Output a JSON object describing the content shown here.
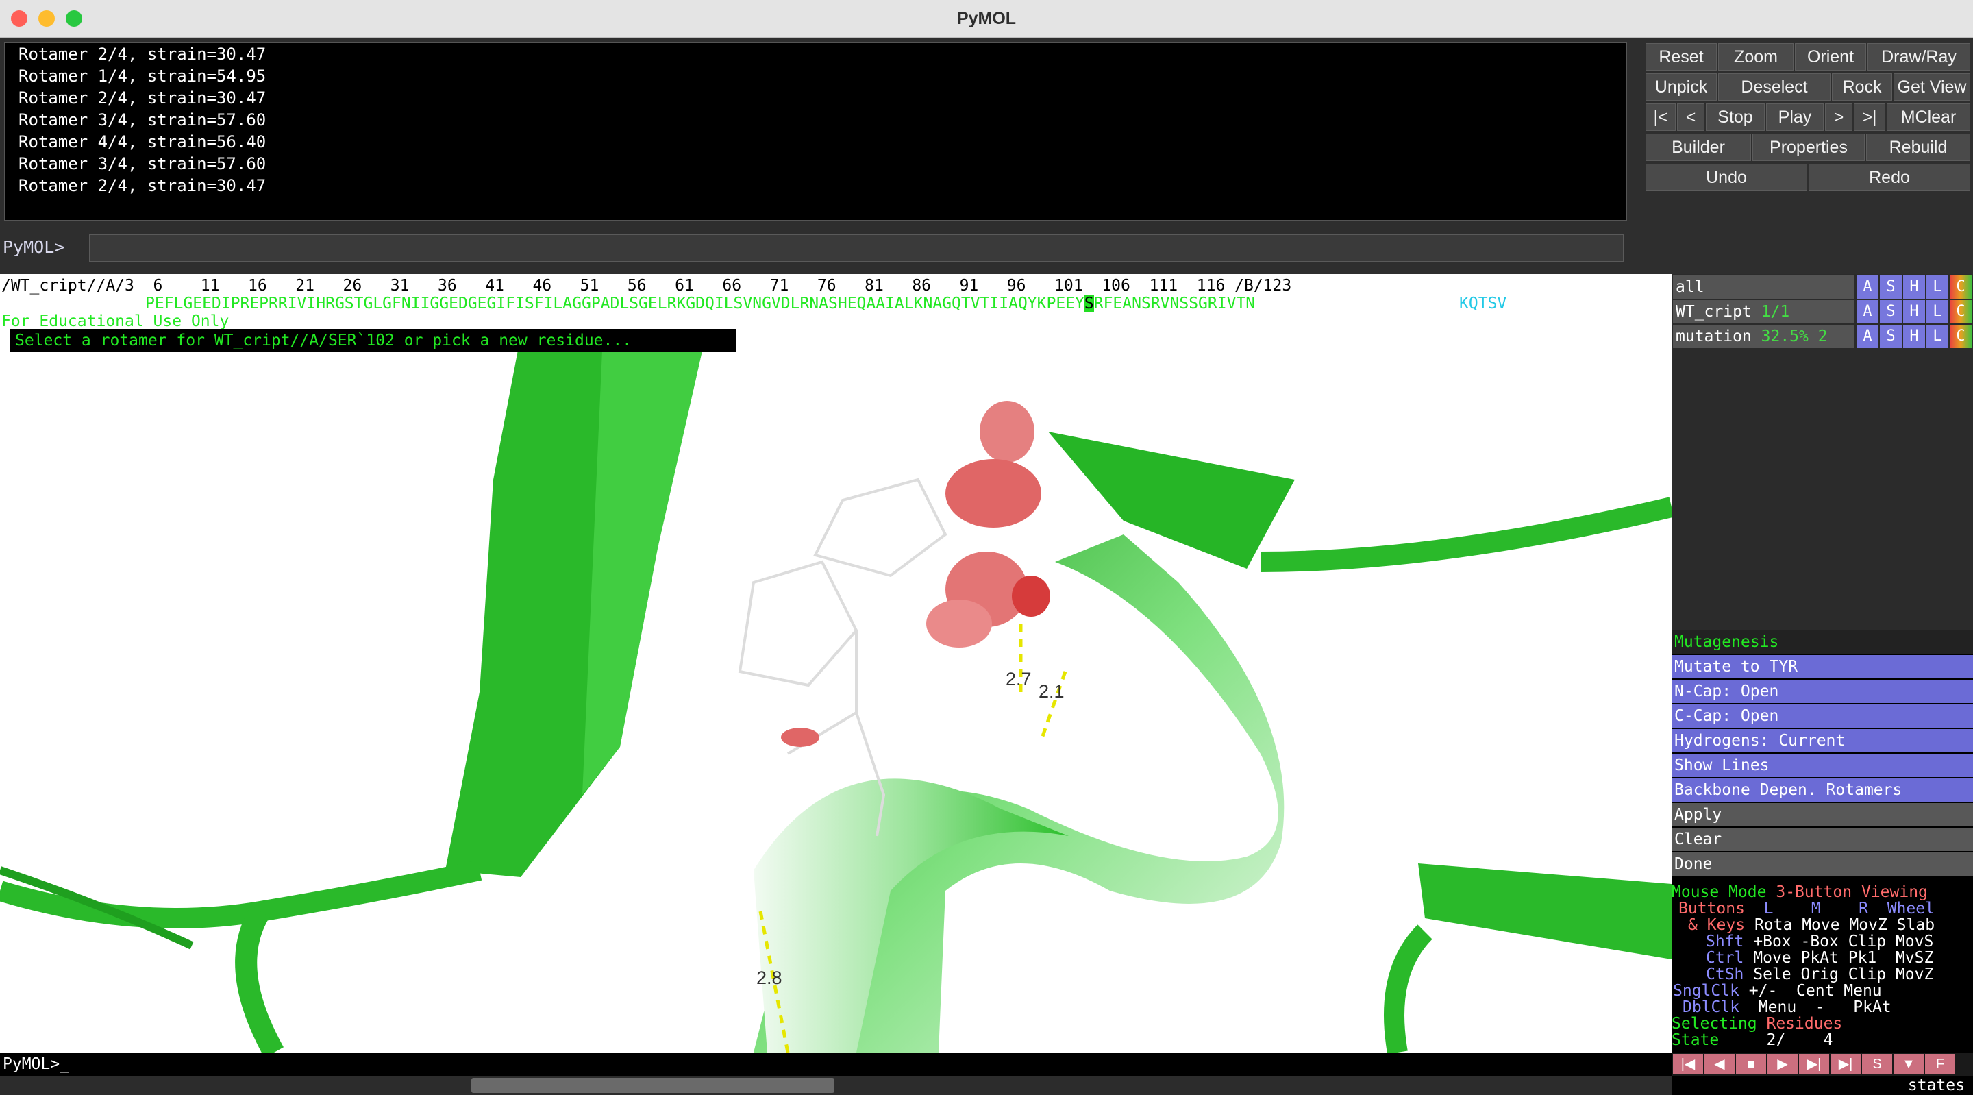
{
  "window": {
    "title": "PyMOL"
  },
  "console": {
    "lines": [
      "Rotamer 2/4, strain=30.47",
      "Rotamer 1/4, strain=54.95",
      "Rotamer 2/4, strain=30.47",
      "Rotamer 3/4, strain=57.60",
      "Rotamer 4/4, strain=56.40",
      "Rotamer 3/4, strain=57.60",
      "Rotamer 2/4, strain=30.47"
    ],
    "prompt_label": "PyMOL>",
    "command_value": ""
  },
  "buttons": {
    "reset": "Reset",
    "zoom": "Zoom",
    "orient": "Orient",
    "draw_ray": "Draw/Ray",
    "unpick": "Unpick",
    "deselect": "Deselect",
    "rock": "Rock",
    "get_view": "Get View",
    "first": "|<",
    "prev": "<",
    "stop": "Stop",
    "play": "Play",
    "next": ">",
    "last": ">|",
    "mclear": "MClear",
    "builder": "Builder",
    "properties": "Properties",
    "rebuild": "Rebuild",
    "undo": "Undo",
    "redo": "Redo"
  },
  "sequence": {
    "numbering": "/WT_cript//A/3  6    11   16   21   26   31   36   41   46   51   56   61   66   71   76   81   86   91   96   101  106  111  116 /B/123",
    "residues_before": "PEFLGEEDIPREPRRIVIHRGSTGLGFNIIGGEDGEGIFISFILAGGPADLSGELRKGDQILSVNGVDLRNASHEQAAIALKNAGQTVTIIAQYKPEEY",
    "residue_current": "S",
    "residues_after": "RFEANSRVNSSGRIVTN",
    "chain_b_residues": "KQTSV",
    "watermark": "For Educational Use Only",
    "message": "Select a rotamer for WT_cript//A/SER`102 or pick a new residue..."
  },
  "distances": [
    "2.7",
    "2.1",
    "2.8"
  ],
  "objects": [
    {
      "name": "all",
      "state": ""
    },
    {
      "name": "WT_cript",
      "state": "1/1"
    },
    {
      "name": "mutation",
      "state": "32.5% 2"
    }
  ],
  "object_buttons": [
    "A",
    "S",
    "H",
    "L",
    "C"
  ],
  "wizard": {
    "title": "Mutagenesis",
    "mutate": "Mutate to TYR",
    "ncap": "N-Cap: Open",
    "ccap": "C-Cap: Open",
    "hydrogens": "Hydrogens: Current",
    "show_lines": "Show Lines",
    "backbone": "Backbone Depen. Rotamers",
    "apply": "Apply",
    "clear": "Clear",
    "done": "Done"
  },
  "mouse": {
    "mode_label": "Mouse Mode",
    "mode_value": "3-Button Viewing",
    "header": {
      "buttons": "Buttons",
      "l": "L",
      "m": "M",
      "r": "R",
      "wheel": "Wheel"
    },
    "rows": [
      {
        "key": "& Keys",
        "vals": "Rota Move MovZ Slab"
      },
      {
        "key": "Shft",
        "vals": "+Box -Box Clip MovS"
      },
      {
        "key": "Ctrl",
        "vals": "Move PkAt Pk1  MvSZ"
      },
      {
        "key": "CtSh",
        "vals": "Sele Orig Clip MovZ"
      },
      {
        "key": "SnglClk",
        "vals": "+/-  Cent Menu"
      },
      {
        "key": "DblClk",
        "vals": "Menu  -   PkAt"
      }
    ],
    "selecting_label": "Selecting",
    "selecting_value": "Residues",
    "state_label": "State",
    "state_value": "2/    4"
  },
  "movie": {
    "buttons": [
      "|◀",
      "◀",
      "■",
      "▶",
      "▶|",
      "▶|",
      "S",
      "▼",
      "F"
    ],
    "states_label": "states"
  },
  "bottom_prompt": "PyMOL>_",
  "colors": {
    "cartoon": "#26c126",
    "rotamer": "#e06666",
    "panel_purple": "#6b6bd6"
  }
}
